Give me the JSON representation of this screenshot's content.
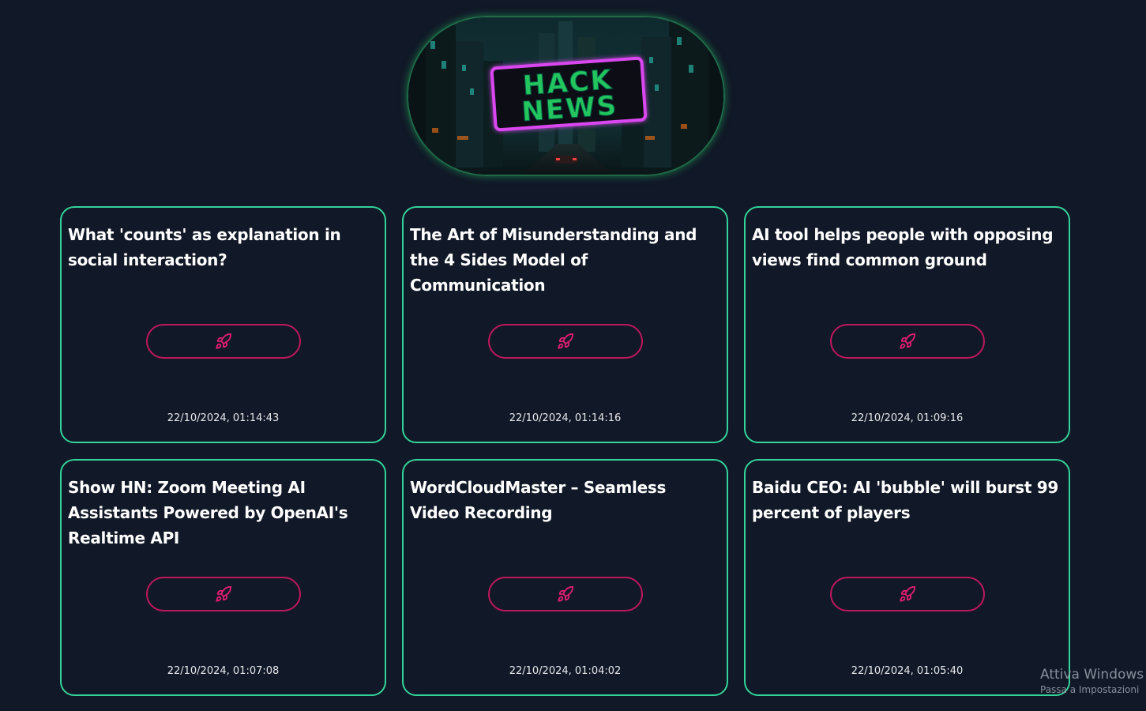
{
  "logo": {
    "line1": "HACK",
    "line2": "NEWS",
    "colors": {
      "text": "#22c55e",
      "glow": "#d946ef",
      "border": "#1f6b48"
    }
  },
  "cards": [
    {
      "title": "What 'counts' as explanation in social interaction?",
      "date": "22/10/2024, 01:14:43",
      "icon": "rocket-icon"
    },
    {
      "title": "The Art of Misunderstanding and the 4 Sides Model of Communication",
      "date": "22/10/2024, 01:14:16",
      "icon": "rocket-icon"
    },
    {
      "title": "AI tool helps people with opposing views find common ground",
      "date": "22/10/2024, 01:09:16",
      "icon": "rocket-icon"
    },
    {
      "title": "Show HN: Zoom Meeting AI Assistants Powered by OpenAI's Realtime API",
      "date": "22/10/2024, 01:07:08",
      "icon": "rocket-icon"
    },
    {
      "title": "WordCloudMaster – Seamless Video Recording",
      "date": "22/10/2024, 01:04:02",
      "icon": "rocket-icon"
    },
    {
      "title": "Baidu CEO: AI 'bubble' will burst 99 percent of players",
      "date": "22/10/2024, 01:05:40",
      "icon": "rocket-icon"
    }
  ],
  "watermark": {
    "line1": "Attiva Windows",
    "line2": "Passa a Impostazioni"
  },
  "colors": {
    "background": "#111827",
    "card_border": "#34d399",
    "button_border": "#be185d",
    "icon": "#e11d74"
  }
}
